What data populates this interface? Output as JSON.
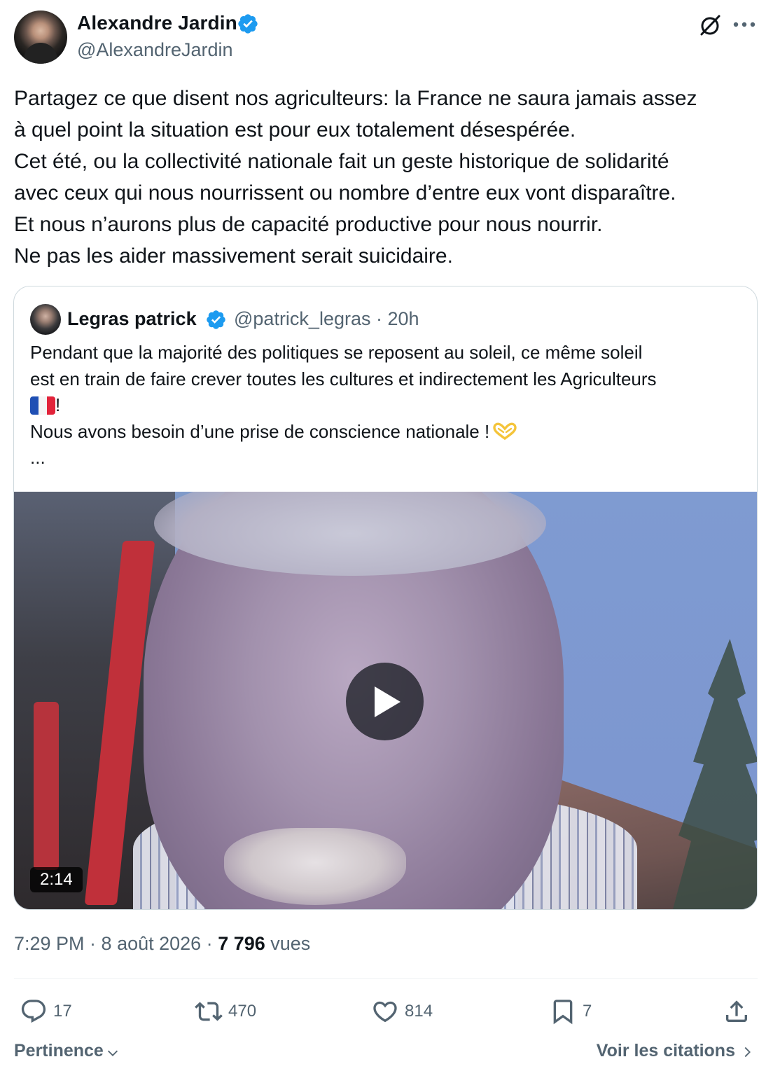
{
  "author": {
    "name": "Alexandre Jardin",
    "handle": "@AlexandreJardin",
    "verified": true
  },
  "tweet": {
    "text": "Partagez ce que disent nos agriculteurs: la France ne saura jamais assez\nà quel point la situation est pour eux totalement désespérée.\nCet été, ou la collectivité nationale fait un geste historique de solidarité\navec ceux qui nous nourrissent ou nombre d’entre eux vont disparaître.\nEt nous n’aurons plus de capacité productive pour nous nourrir.\nNe pas les aider massivement serait suicidaire."
  },
  "quote": {
    "name": "Legras patrick",
    "verified": true,
    "meta": "@patrick_legras · 20h",
    "line1": "Pendant que la majorité des politiques se reposent au soleil, ce même soleil",
    "line2": "est en train de faire crever toutes les cultures et indirectement les  Agriculteurs",
    "line3_suffix": "!",
    "line4": "Nous avons besoin d’une prise de conscience nationale !",
    "line5": "...",
    "video_duration": "2:14"
  },
  "meta": {
    "time": "7:29 PM · 8 août 2026 · ",
    "views_count": "7 796",
    "views_label": " vues"
  },
  "actions": {
    "replies": "17",
    "retweets": "470",
    "likes": "814",
    "bookmarks": "7"
  },
  "footer": {
    "sort_label": "Pertinence",
    "quotes_link": "Voir les citations"
  },
  "icons": [
    "verified-badge-icon",
    "grok-icon",
    "more-icon",
    "play-icon",
    "reply-icon",
    "retweet-icon",
    "like-icon",
    "bookmark-icon",
    "share-icon",
    "chevron-down-icon",
    "chevron-right-icon",
    "france-flag-icon",
    "heart-hands-icon"
  ],
  "colors": {
    "verified": "#1d9bf0",
    "secondary_text": "#536471",
    "border": "#cfd9de"
  }
}
